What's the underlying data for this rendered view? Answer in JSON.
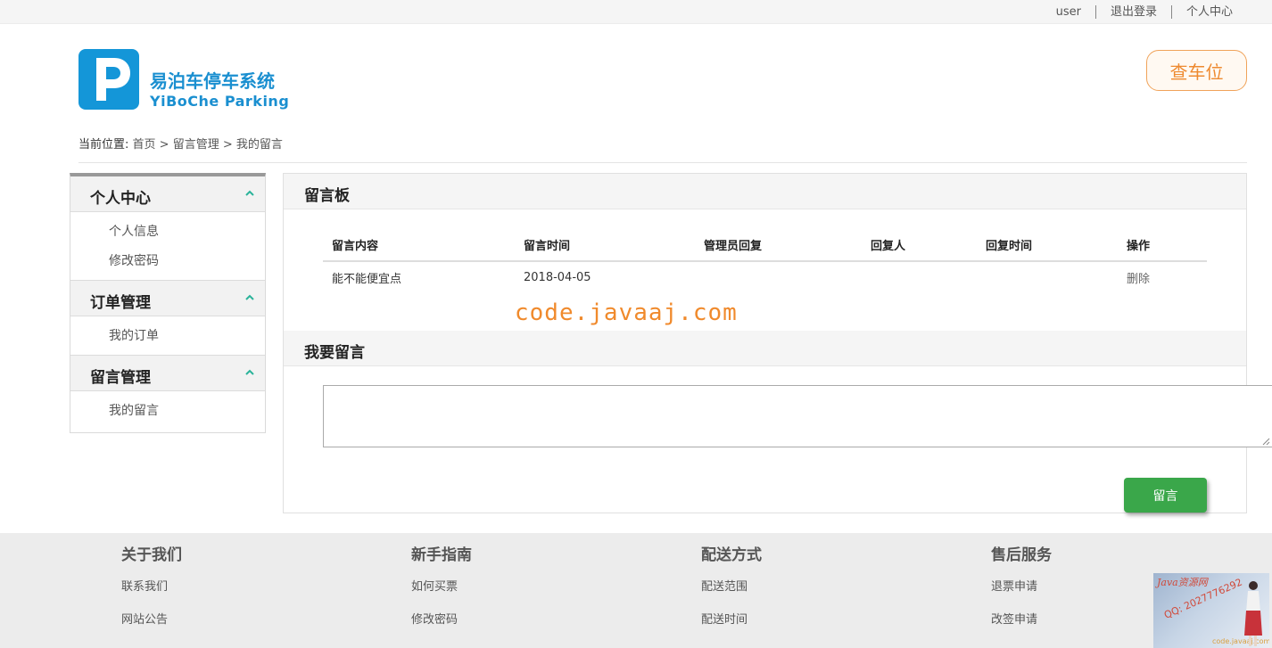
{
  "topbar": {
    "user": "user",
    "logout": "退出登录",
    "profile": "个人中心"
  },
  "logo": {
    "cn": "易泊车停车系统",
    "en": "YiBoChe  Parking"
  },
  "header": {
    "find_button": "查车位"
  },
  "breadcrumb": {
    "label": "当前位置:",
    "path": "首页 > 留言管理 > 我的留言"
  },
  "sidebar": {
    "groups": [
      {
        "title": "个人中心",
        "items": [
          "个人信息",
          "修改密码"
        ]
      },
      {
        "title": "订单管理",
        "items": [
          "我的订单"
        ]
      },
      {
        "title": "留言管理",
        "items": [
          "我的留言"
        ]
      }
    ]
  },
  "board": {
    "title": "留言板",
    "columns": [
      "留言内容",
      "留言时间",
      "管理员回复",
      "回复人",
      "回复时间",
      "操作"
    ],
    "rows": [
      {
        "content": "能不能便宜点",
        "time": "2018-04-05",
        "reply": "",
        "replier": "",
        "reply_time": "",
        "action": "删除"
      }
    ]
  },
  "watermark": "code.javaaj.com",
  "compose": {
    "title": "我要留言",
    "value": "",
    "submit": "留言"
  },
  "footer": {
    "columns": [
      {
        "title": "关于我们",
        "links": [
          "联系我们",
          "网站公告"
        ]
      },
      {
        "title": "新手指南",
        "links": [
          "如何买票",
          "修改密码"
        ]
      },
      {
        "title": "配送方式",
        "links": [
          "配送范围",
          "配送时间"
        ]
      },
      {
        "title": "售后服务",
        "links": [
          "退票申请",
          "改签申请"
        ]
      }
    ]
  },
  "stamp": {
    "line1": "Java资源网",
    "line2": "QQ: 2027776292",
    "line3": "code.javaaj.com"
  },
  "colors": {
    "brand_blue": "#1496d8",
    "accent_orange": "#ee8a30",
    "button_green": "#3aa74a",
    "chevron_teal": "#2bb39a"
  }
}
